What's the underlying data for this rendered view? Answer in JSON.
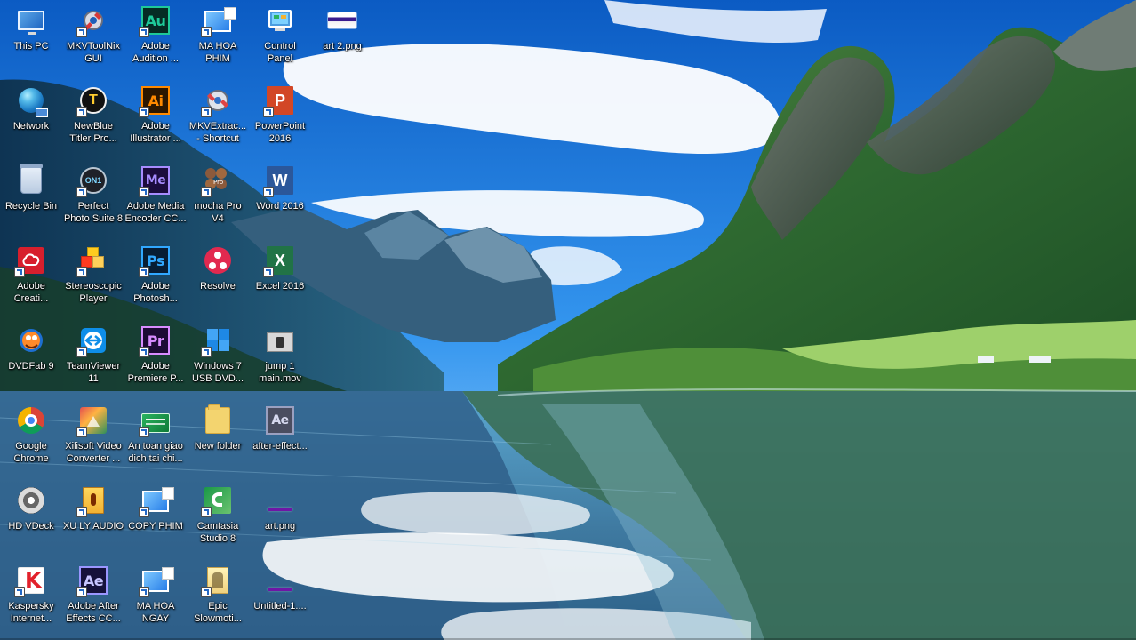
{
  "desktop": {
    "icons": [
      {
        "label": "This PC",
        "icon": "this-pc-icon"
      },
      {
        "label": "MKVToolNix\nGUI",
        "icon": "mkvtoolnix-icon"
      },
      {
        "label": "Adobe\nAudition ...",
        "icon": "adobe-audition-icon"
      },
      {
        "label": "MA HOA\nPHIM",
        "icon": "monitor-shortcut-icon"
      },
      {
        "label": "Control\nPanel",
        "icon": "control-panel-icon"
      },
      {
        "label": "art 2.png",
        "icon": "png-file-icon"
      },
      {
        "label": "Network",
        "icon": "network-icon"
      },
      {
        "label": "NewBlue\nTitler Pro...",
        "icon": "newblue-titler-icon"
      },
      {
        "label": "Adobe\nIllustrator ...",
        "icon": "adobe-illustrator-icon"
      },
      {
        "label": "MKVExtrac...\n- Shortcut",
        "icon": "mkvextract-icon"
      },
      {
        "label": "PowerPoint\n2016",
        "icon": "powerpoint-icon"
      },
      {
        "label": "",
        "icon": ""
      },
      {
        "label": "Recycle Bin",
        "icon": "recycle-bin-icon"
      },
      {
        "label": "Perfect\nPhoto Suite 8",
        "icon": "perfect-photo-suite-icon"
      },
      {
        "label": "Adobe Media\nEncoder CC...",
        "icon": "adobe-media-encoder-icon"
      },
      {
        "label": "mocha Pro\nV4",
        "icon": "mocha-pro-icon"
      },
      {
        "label": "Word 2016",
        "icon": "word-icon"
      },
      {
        "label": "",
        "icon": ""
      },
      {
        "label": "Adobe\nCreati...",
        "icon": "adobe-creative-cloud-icon"
      },
      {
        "label": "Stereoscopic\nPlayer",
        "icon": "stereoscopic-player-icon"
      },
      {
        "label": "Adobe\nPhotosh...",
        "icon": "adobe-photoshop-icon"
      },
      {
        "label": "Resolve",
        "icon": "resolve-icon"
      },
      {
        "label": "Excel 2016",
        "icon": "excel-icon"
      },
      {
        "label": "",
        "icon": ""
      },
      {
        "label": "DVDFab 9",
        "icon": "dvdfab-icon"
      },
      {
        "label": "TeamViewer\n11",
        "icon": "teamviewer-icon"
      },
      {
        "label": "Adobe\nPremiere P...",
        "icon": "adobe-premiere-icon"
      },
      {
        "label": "Windows 7\nUSB DVD...",
        "icon": "windows-usb-icon"
      },
      {
        "label": "jump 1\nmain.mov",
        "icon": "video-file-icon"
      },
      {
        "label": "",
        "icon": ""
      },
      {
        "label": "Google\nChrome",
        "icon": "chrome-icon"
      },
      {
        "label": "Xilisoft Video\nConverter ...",
        "icon": "xilisoft-icon"
      },
      {
        "label": "An toan giao\ndich tai chi...",
        "icon": "bank-security-icon"
      },
      {
        "label": "New folder",
        "icon": "folder-icon"
      },
      {
        "label": "after-effect...",
        "icon": "after-effects-file-icon"
      },
      {
        "label": "",
        "icon": ""
      },
      {
        "label": "HD VDeck",
        "icon": "hd-vdeck-icon"
      },
      {
        "label": "XU LY AUDIO",
        "icon": "audio-folder-icon"
      },
      {
        "label": "COPY PHIM",
        "icon": "copy-monitor-icon"
      },
      {
        "label": "Camtasia\nStudio 8",
        "icon": "camtasia-icon"
      },
      {
        "label": "art.png",
        "icon": "png-file-thin-icon"
      },
      {
        "label": "",
        "icon": ""
      },
      {
        "label": "Kaspersky\nInternet...",
        "icon": "kaspersky-icon"
      },
      {
        "label": "Adobe After\nEffects CC...",
        "icon": "adobe-after-effects-icon"
      },
      {
        "label": "MA HOA\nNGAY",
        "icon": "monitor-shortcut-icon"
      },
      {
        "label": "Epic\nSlowmoti...",
        "icon": "epic-slowmotion-icon"
      },
      {
        "label": "Untitled-1....",
        "icon": "png-file-thin-icon"
      },
      {
        "label": "",
        "icon": ""
      }
    ]
  },
  "theme": {
    "sky_top": "#0d5fc5",
    "sky_mid": "#3f9ef2",
    "lake": "#3b87b8",
    "mountains": "#2c5d3a"
  }
}
